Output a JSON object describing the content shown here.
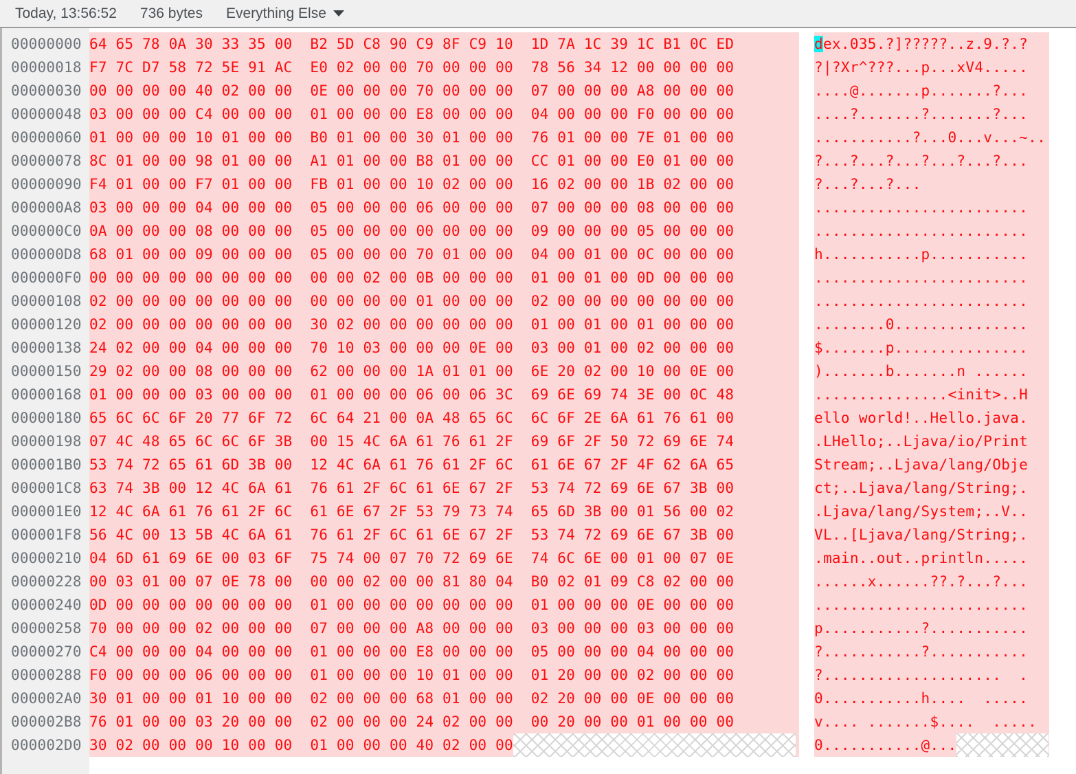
{
  "header": {
    "timestamp": "Today, 13:56:52",
    "size": "736 bytes",
    "category": "Everything Else",
    "caret_icon": "chevron-down-icon"
  },
  "colors": {
    "hex_text": "#fb0d10",
    "hex_background": "#fcd8d8",
    "address_text": "#6e7478",
    "address_background": "#f0f0f0",
    "cursor_highlight": "#0ff0f5",
    "header_text": "#4a5055",
    "header_background": "#f0f0f0"
  },
  "view": {
    "bytes_per_row": 24,
    "group_size": 8,
    "cursor_offset": 0
  },
  "rows": [
    {
      "address": "00000000",
      "hex": [
        "64 65 78 0A 30 33 35 00",
        "B2 5D C8 90 C9 8F C9 10",
        "1D 7A 1C 39 1C B1 0C ED"
      ],
      "ascii": "dex.035.?]?????..z.9.?.?"
    },
    {
      "address": "00000018",
      "hex": [
        "F7 7C D7 58 72 5E 91 AC",
        "E0 02 00 00 70 00 00 00",
        "78 56 34 12 00 00 00 00"
      ],
      "ascii": "?|?Xr^???...p...xV4....."
    },
    {
      "address": "00000030",
      "hex": [
        "00 00 00 00 40 02 00 00",
        "0E 00 00 00 70 00 00 00",
        "07 00 00 00 A8 00 00 00"
      ],
      "ascii": "....@.......p.......?..."
    },
    {
      "address": "00000048",
      "hex": [
        "03 00 00 00 C4 00 00 00",
        "01 00 00 00 E8 00 00 00",
        "04 00 00 00 F0 00 00 00"
      ],
      "ascii": "....?.......?.......?..."
    },
    {
      "address": "00000060",
      "hex": [
        "01 00 00 00 10 01 00 00",
        "B0 01 00 00 30 01 00 00",
        "76 01 00 00 7E 01 00 00"
      ],
      "ascii": "...........?...0...v...~..."
    },
    {
      "address": "00000078",
      "hex": [
        "8C 01 00 00 98 01 00 00",
        "A1 01 00 00 B8 01 00 00",
        "CC 01 00 00 E0 01 00 00"
      ],
      "ascii": "?...?...?...?...?...?..."
    },
    {
      "address": "00000090",
      "hex": [
        "F4 01 00 00 F7 01 00 00",
        "FB 01 00 00 10 02 00 00",
        "16 02 00 00 1B 02 00 00"
      ],
      "ascii": "?...?...?..."
    },
    {
      "address": "000000A8",
      "hex": [
        "03 00 00 00 04 00 00 00",
        "05 00 00 00 06 00 00 00",
        "07 00 00 00 08 00 00 00"
      ],
      "ascii": "........................"
    },
    {
      "address": "000000C0",
      "hex": [
        "0A 00 00 00 08 00 00 00",
        "05 00 00 00 00 00 00 00",
        "09 00 00 00 05 00 00 00"
      ],
      "ascii": "........................"
    },
    {
      "address": "000000D8",
      "hex": [
        "68 01 00 00 09 00 00 00",
        "05 00 00 00 70 01 00 00",
        "04 00 01 00 0C 00 00 00"
      ],
      "ascii": "h...........p..........."
    },
    {
      "address": "000000F0",
      "hex": [
        "00 00 00 00 00 00 00 00",
        "00 00 02 00 0B 00 00 00",
        "01 00 01 00 0D 00 00 00"
      ],
      "ascii": "........................"
    },
    {
      "address": "00000108",
      "hex": [
        "02 00 00 00 00 00 00 00",
        "00 00 00 00 01 00 00 00",
        "02 00 00 00 00 00 00 00"
      ],
      "ascii": "........................"
    },
    {
      "address": "00000120",
      "hex": [
        "02 00 00 00 00 00 00 00",
        "30 02 00 00 00 00 00 00",
        "01 00 01 00 01 00 00 00"
      ],
      "ascii": "........0..............."
    },
    {
      "address": "00000138",
      "hex": [
        "24 02 00 00 04 00 00 00",
        "70 10 03 00 00 00 0E 00",
        "03 00 01 00 02 00 00 00"
      ],
      "ascii": "$.......p..............."
    },
    {
      "address": "00000150",
      "hex": [
        "29 02 00 00 08 00 00 00",
        "62 00 00 00 1A 01 01 00",
        "6E 20 02 00 10 00 0E 00"
      ],
      "ascii": ").......b.......n ......"
    },
    {
      "address": "00000168",
      "hex": [
        "01 00 00 00 03 00 00 00",
        "01 00 00 00 06 00 06 3C",
        "69 6E 69 74 3E 00 0C 48"
      ],
      "ascii": "...............<init>..H"
    },
    {
      "address": "00000180",
      "hex": [
        "65 6C 6C 6F 20 77 6F 72",
        "6C 64 21 00 0A 48 65 6C",
        "6C 6F 2E 6A 61 76 61 00"
      ],
      "ascii": "ello world!..Hello.java."
    },
    {
      "address": "00000198",
      "hex": [
        "07 4C 48 65 6C 6C 6F 3B",
        "00 15 4C 6A 61 76 61 2F",
        "69 6F 2F 50 72 69 6E 74"
      ],
      "ascii": ".LHello;..Ljava/io/Print"
    },
    {
      "address": "000001B0",
      "hex": [
        "53 74 72 65 61 6D 3B 00",
        "12 4C 6A 61 76 61 2F 6C",
        "61 6E 67 2F 4F 62 6A 65"
      ],
      "ascii": "Stream;..Ljava/lang/Obje"
    },
    {
      "address": "000001C8",
      "hex": [
        "63 74 3B 00 12 4C 6A 61",
        "76 61 2F 6C 61 6E 67 2F",
        "53 74 72 69 6E 67 3B 00"
      ],
      "ascii": "ct;..Ljava/lang/String;."
    },
    {
      "address": "000001E0",
      "hex": [
        "12 4C 6A 61 76 61 2F 6C",
        "61 6E 67 2F 53 79 73 74",
        "65 6D 3B 00 01 56 00 02"
      ],
      "ascii": ".Ljava/lang/System;..V.."
    },
    {
      "address": "000001F8",
      "hex": [
        "56 4C 00 13 5B 4C 6A 61",
        "76 61 2F 6C 61 6E 67 2F",
        "53 74 72 69 6E 67 3B 00"
      ],
      "ascii": "VL..[Ljava/lang/String;."
    },
    {
      "address": "00000210",
      "hex": [
        "04 6D 61 69 6E 00 03 6F",
        "75 74 00 07 70 72 69 6E",
        "74 6C 6E 00 01 00 07 0E"
      ],
      "ascii": ".main..out..println....."
    },
    {
      "address": "00000228",
      "hex": [
        "00 03 01 00 07 0E 78 00",
        "00 00 02 00 00 81 80 04",
        "B0 02 01 09 C8 02 00 00"
      ],
      "ascii": "......x......??.?...?..."
    },
    {
      "address": "00000240",
      "hex": [
        "0D 00 00 00 00 00 00 00",
        "01 00 00 00 00 00 00 00",
        "01 00 00 00 0E 00 00 00"
      ],
      "ascii": "........................"
    },
    {
      "address": "00000258",
      "hex": [
        "70 00 00 00 02 00 00 00",
        "07 00 00 00 A8 00 00 00",
        "03 00 00 00 03 00 00 00"
      ],
      "ascii": "p...........?..........."
    },
    {
      "address": "00000270",
      "hex": [
        "C4 00 00 00 04 00 00 00",
        "01 00 00 00 E8 00 00 00",
        "05 00 00 00 04 00 00 00"
      ],
      "ascii": "?...........?..........."
    },
    {
      "address": "00000288",
      "hex": [
        "F0 00 00 00 06 00 00 00",
        "01 00 00 00 10 01 00 00",
        "01 20 00 00 02 00 00 00"
      ],
      "ascii": "?....................  ."
    },
    {
      "address": "000002A0",
      "hex": [
        "30 01 00 00 01 10 00 00",
        "02 00 00 00 68 01 00 00",
        "02 20 00 00 0E 00 00 00"
      ],
      "ascii": "0...........h....  ....."
    },
    {
      "address": "000002B8",
      "hex": [
        "76 01 00 00 03 20 00 00",
        "02 00 00 00 24 02 00 00",
        "00 20 00 00 01 00 00 00"
      ],
      "ascii": "v.... .......$....  ....."
    },
    {
      "address": "000002D0",
      "hex": [
        "30 02 00 00 00 10 00 00",
        "01 00 00 00 40 02 00 00"
      ],
      "ascii": "0...........@...",
      "partial": true
    }
  ]
}
